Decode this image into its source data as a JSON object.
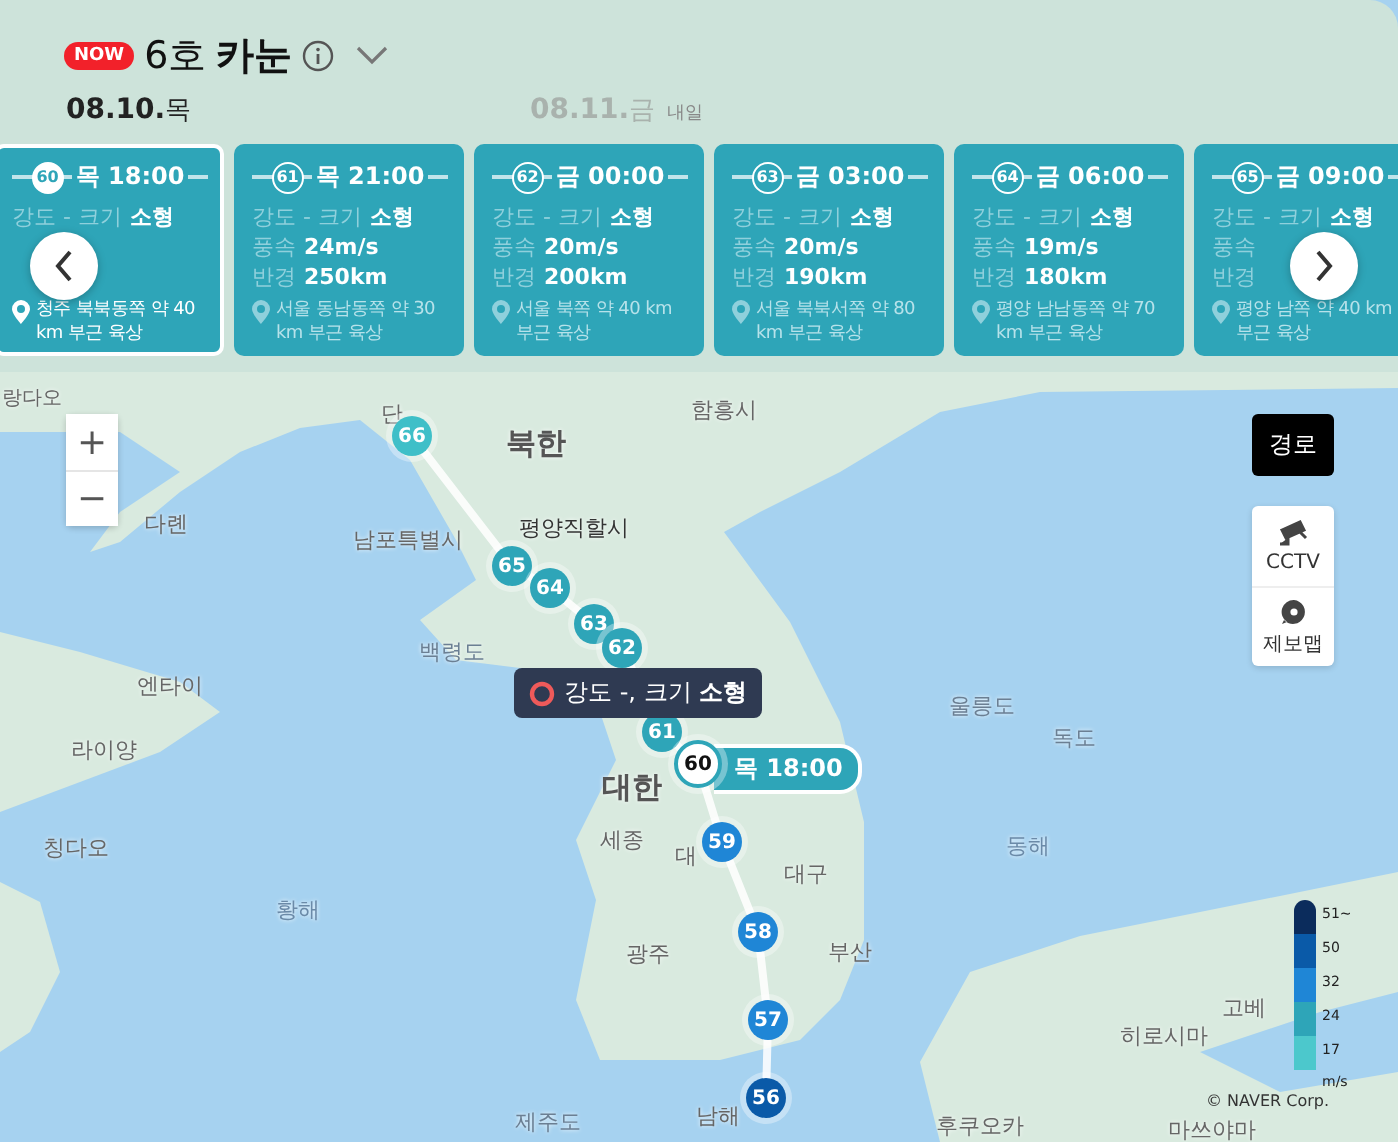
{
  "header": {
    "badge": "NOW",
    "number": "6호",
    "name": "카눈"
  },
  "dates": [
    {
      "date": "08.10.",
      "weekday": "목",
      "selected": true
    },
    {
      "date": "08.11.",
      "weekday": "금",
      "note": "내일",
      "selected": false
    }
  ],
  "forecasts": [
    {
      "number": "60",
      "time": "목 18:00",
      "intensity_label": "강도 - 크기",
      "size": "소형",
      "location": "청주 북북동쪽 약 40 km 부근 육상",
      "selected": true
    },
    {
      "number": "61",
      "time": "목 21:00",
      "intensity_label": "강도 - 크기",
      "size": "소형",
      "wind_label": "풍속",
      "wind": "24m/s",
      "radius_label": "반경",
      "radius": "250km",
      "location": "서울 동남동쪽 약 30 km 부근 육상",
      "selected": false
    },
    {
      "number": "62",
      "time": "금 00:00",
      "intensity_label": "강도 - 크기",
      "size": "소형",
      "wind_label": "풍속",
      "wind": "20m/s",
      "radius_label": "반경",
      "radius": "200km",
      "location": "서울 북쪽 약 40 km 부근 육상",
      "selected": false
    },
    {
      "number": "63",
      "time": "금 03:00",
      "intensity_label": "강도 - 크기",
      "size": "소형",
      "wind_label": "풍속",
      "wind": "20m/s",
      "radius_label": "반경",
      "radius": "190km",
      "location": "서울 북북서쪽 약 80 km 부근 육상",
      "selected": false
    },
    {
      "number": "64",
      "time": "금 06:00",
      "intensity_label": "강도 - 크기",
      "size": "소형",
      "wind_label": "풍속",
      "wind": "19m/s",
      "radius_label": "반경",
      "radius": "180km",
      "location": "평양 남남동쪽 약 70 km 부근 육상",
      "selected": false
    },
    {
      "number": "65",
      "time": "금 09:00",
      "intensity_label": "강도 - 크기",
      "size": "소형",
      "wind_label": "풍속",
      "radius_label": "반경",
      "location": "평양 남쪽 약 40 km 부근 육상",
      "selected": false
    }
  ],
  "map": {
    "zoom_controls": [
      "+",
      "−"
    ],
    "route_button": "경로",
    "tools": [
      {
        "kind": "cctv",
        "label": "CCTV"
      },
      {
        "kind": "report",
        "label": "제보맵"
      }
    ],
    "places": [
      {
        "name": "랑다오",
        "kind": "city"
      },
      {
        "name": "단",
        "kind": "city"
      },
      {
        "name": "북한",
        "kind": "country"
      },
      {
        "name": "함흥시",
        "kind": "city"
      },
      {
        "name": "다롄",
        "kind": "city"
      },
      {
        "name": "남포특별시",
        "kind": "city"
      },
      {
        "name": "평양직할시",
        "kind": "capital"
      },
      {
        "name": "백령도",
        "kind": "island"
      },
      {
        "name": "엔타이",
        "kind": "city"
      },
      {
        "name": "라이양",
        "kind": "city"
      },
      {
        "name": "칭다오",
        "kind": "city"
      },
      {
        "name": "황해",
        "kind": "sea"
      },
      {
        "name": "울릉도",
        "kind": "island"
      },
      {
        "name": "독도",
        "kind": "island"
      },
      {
        "name": "대한",
        "kind": "country"
      },
      {
        "name": "세종",
        "kind": "city"
      },
      {
        "name": "대",
        "kind": "city"
      },
      {
        "name": "대구",
        "kind": "city"
      },
      {
        "name": "부산",
        "kind": "city"
      },
      {
        "name": "광주",
        "kind": "city"
      },
      {
        "name": "동해",
        "kind": "sea"
      },
      {
        "name": "제주도",
        "kind": "island"
      },
      {
        "name": "남해",
        "kind": "city"
      },
      {
        "name": "후쿠오카",
        "kind": "city"
      },
      {
        "name": "히로시마",
        "kind": "city"
      },
      {
        "name": "고베",
        "kind": "city"
      },
      {
        "name": "마쓰야마",
        "kind": "city"
      }
    ],
    "track": [
      {
        "number": "66",
        "color": "#3fbfc8",
        "selected": false
      },
      {
        "number": "65",
        "color": "#2ea5b8",
        "selected": false
      },
      {
        "number": "64",
        "color": "#2ea5b8",
        "selected": false
      },
      {
        "number": "63",
        "color": "#2ea5b8",
        "selected": false
      },
      {
        "number": "62",
        "color": "#2ea5b8",
        "selected": false
      },
      {
        "number": "61",
        "color": "#2ea5b8",
        "selected": false
      },
      {
        "number": "60",
        "color": "#2ea5b8",
        "selected": true,
        "time": "목 18:00"
      },
      {
        "number": "59",
        "color": "#1f86d6",
        "selected": false
      },
      {
        "number": "58",
        "color": "#1f86d6",
        "selected": false
      },
      {
        "number": "57",
        "color": "#1f86d6",
        "selected": false
      },
      {
        "number": "56",
        "color": "#0a5aa8",
        "selected": false
      }
    ],
    "tooltip": "강도 -, 크기 **소형**",
    "legend": {
      "labels": [
        "51~",
        "50",
        "32",
        "24",
        "17"
      ],
      "unit": "m/s"
    },
    "copyright": "© NAVER Corp."
  }
}
